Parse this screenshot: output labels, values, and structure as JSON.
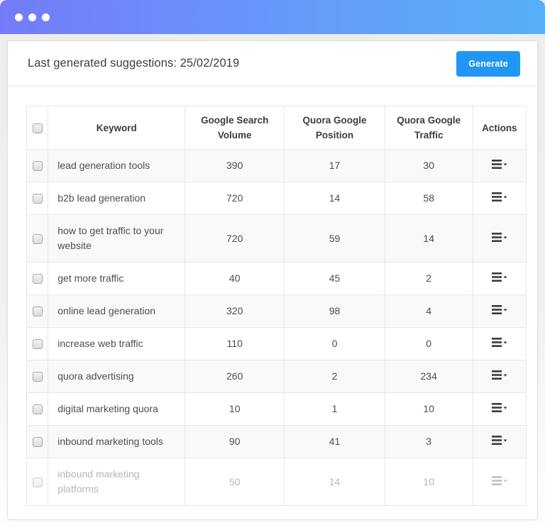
{
  "window": {
    "dots_count": 3
  },
  "header": {
    "title": "Last generated suggestions: 25/02/2019",
    "generate_label": "Generate"
  },
  "table": {
    "columns": [
      "Keyword",
      "Google Search Volume",
      "Quora Google Position",
      "Quora Google Traffic",
      "Actions"
    ],
    "rows": [
      {
        "keyword": "lead generation tools",
        "google_search_volume": "390",
        "quora_google_position": "17",
        "quora_google_traffic": "30",
        "faded": false
      },
      {
        "keyword": "b2b lead generation",
        "google_search_volume": "720",
        "quora_google_position": "14",
        "quora_google_traffic": "58",
        "faded": false
      },
      {
        "keyword": "how to get traffic to your website",
        "google_search_volume": "720",
        "quora_google_position": "59",
        "quora_google_traffic": "14",
        "faded": false
      },
      {
        "keyword": "get more traffic",
        "google_search_volume": "40",
        "quora_google_position": "45",
        "quora_google_traffic": "2",
        "faded": false
      },
      {
        "keyword": "online lead generation",
        "google_search_volume": "320",
        "quora_google_position": "98",
        "quora_google_traffic": "4",
        "faded": false
      },
      {
        "keyword": "increase web traffic",
        "google_search_volume": "110",
        "quora_google_position": "0",
        "quora_google_traffic": "0",
        "faded": false
      },
      {
        "keyword": "quora advertising",
        "google_search_volume": "260",
        "quora_google_position": "2",
        "quora_google_traffic": "234",
        "faded": false
      },
      {
        "keyword": "digital marketing quora",
        "google_search_volume": "10",
        "quora_google_position": "1",
        "quora_google_traffic": "10",
        "faded": false
      },
      {
        "keyword": "inbound marketing tools",
        "google_search_volume": "90",
        "quora_google_position": "41",
        "quora_google_traffic": "3",
        "faded": false
      },
      {
        "keyword": "inbound marketing platforms",
        "google_search_volume": "50",
        "quora_google_position": "14",
        "quora_google_traffic": "10",
        "faded": true
      }
    ]
  },
  "colors": {
    "titlebar_gradient_start": "#747bf8",
    "titlebar_gradient_end": "#57aff8",
    "accent": "#2196f3",
    "row_stripe": "#f9f9f9",
    "table_border": "#e7e7e7",
    "text": "#4d4d4d",
    "faded_text": "#b6b6b6"
  }
}
